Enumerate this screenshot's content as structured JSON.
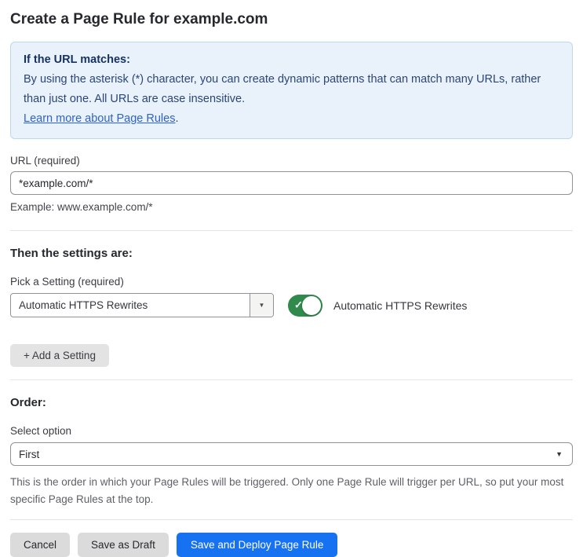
{
  "page": {
    "title": "Create a Page Rule for example.com"
  },
  "notice": {
    "heading": "If the URL matches:",
    "body": "By using the asterisk (*) character, you can create dynamic patterns that can match many URLs, rather than just one. All URLs are case insensitive.",
    "link_text": "Learn more about Page Rules",
    "link_suffix": "."
  },
  "url_section": {
    "label": "URL (required)",
    "input_value": "*example.com/*",
    "helper": "Example: www.example.com/*"
  },
  "settings_section": {
    "heading": "Then the settings are:",
    "picker_label": "Pick a Setting (required)",
    "picker_value": "Automatic HTTPS Rewrites",
    "toggle_state": "on",
    "toggle_label": "Automatic HTTPS Rewrites",
    "add_setting_label": "+ Add a Setting"
  },
  "order_section": {
    "heading": "Order:",
    "select_label": "Select option",
    "select_value": "First",
    "helper": "This is the order in which your Page Rules will be triggered. Only one Page Rule will trigger per URL, so put your most specific Page Rules at the top."
  },
  "footer": {
    "cancel_label": "Cancel",
    "save_draft_label": "Save as Draft",
    "save_deploy_label": "Save and Deploy Page Rule"
  },
  "icons": {
    "caret_down": "▼",
    "check": "✓"
  },
  "colors": {
    "primary_blue": "#1672f0",
    "toggle_green": "#2f8a4b",
    "notice_bg": "#e9f1fb",
    "notice_border": "#bed7f0",
    "notice_heading_text": "#17325e",
    "notice_body_text": "#2b4677",
    "link_blue": "#2d63cc"
  }
}
